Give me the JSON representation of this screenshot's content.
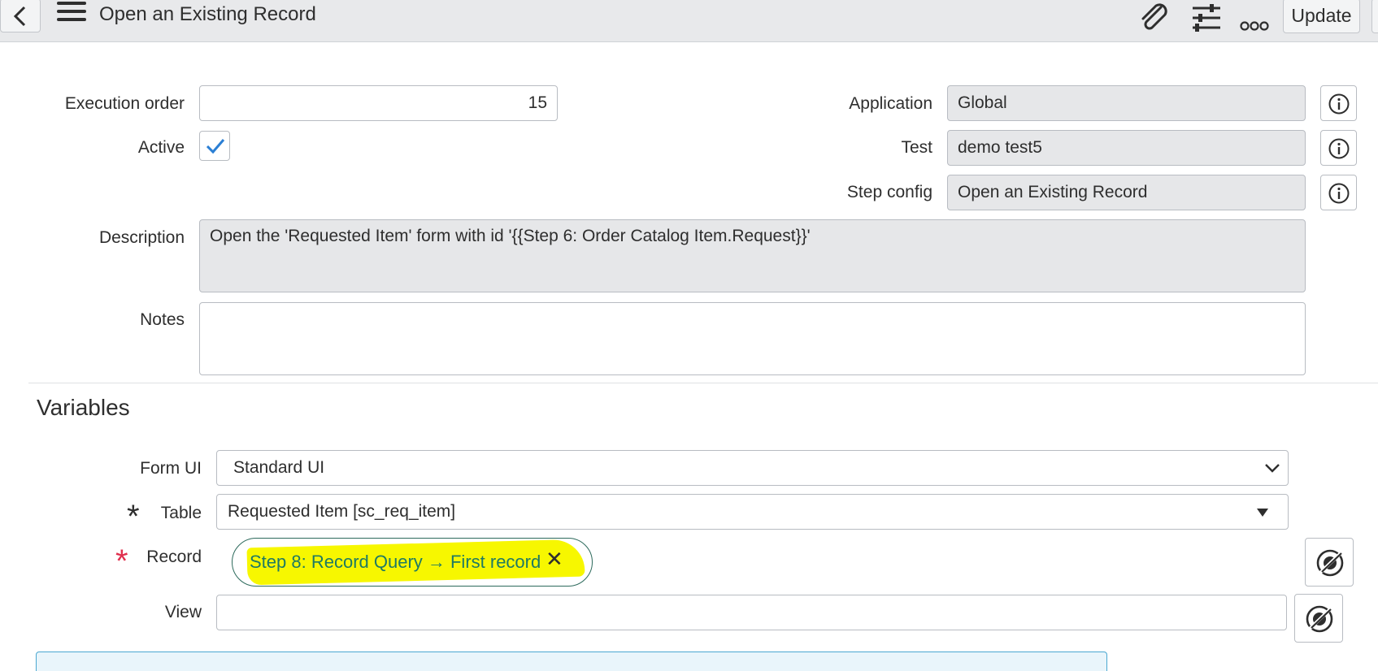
{
  "header": {
    "title": "Open an Existing Record",
    "update_label": "Update",
    "icons": [
      "back-icon",
      "hamburger-menu-icon",
      "paperclip-icon",
      "sliders-icon",
      "more-icon"
    ]
  },
  "form": {
    "execution_order": {
      "label": "Execution order",
      "value": "15"
    },
    "active": {
      "label": "Active",
      "checked": true
    },
    "application": {
      "label": "Application",
      "value": "Global"
    },
    "test": {
      "label": "Test",
      "value": "demo test5"
    },
    "step_config": {
      "label": "Step config",
      "value": "Open an Existing Record"
    },
    "description": {
      "label": "Description",
      "value": "Open the 'Requested Item' form with id '{{Step 6: Order Catalog Item.Request}}'"
    },
    "notes": {
      "label": "Notes",
      "value": ""
    }
  },
  "variables": {
    "title": "Variables",
    "form_ui": {
      "label": "Form UI",
      "value": "Standard UI"
    },
    "table": {
      "label": "Table",
      "value": "Requested Item [sc_req_item]",
      "required": true
    },
    "record": {
      "label": "Record",
      "value": "Step 8: Record Query → First record",
      "required": true
    },
    "view": {
      "label": "View",
      "value": ""
    }
  },
  "colors": {
    "header_bg": "#e8e9eb",
    "readonly_bg": "#e6e7e9",
    "checkbox_check": "#2b7fd4",
    "required_red": "#e0304e",
    "pill_text": "#1f7a63",
    "highlight": "#f7f700",
    "info_panel_border": "#4aa7d1"
  }
}
